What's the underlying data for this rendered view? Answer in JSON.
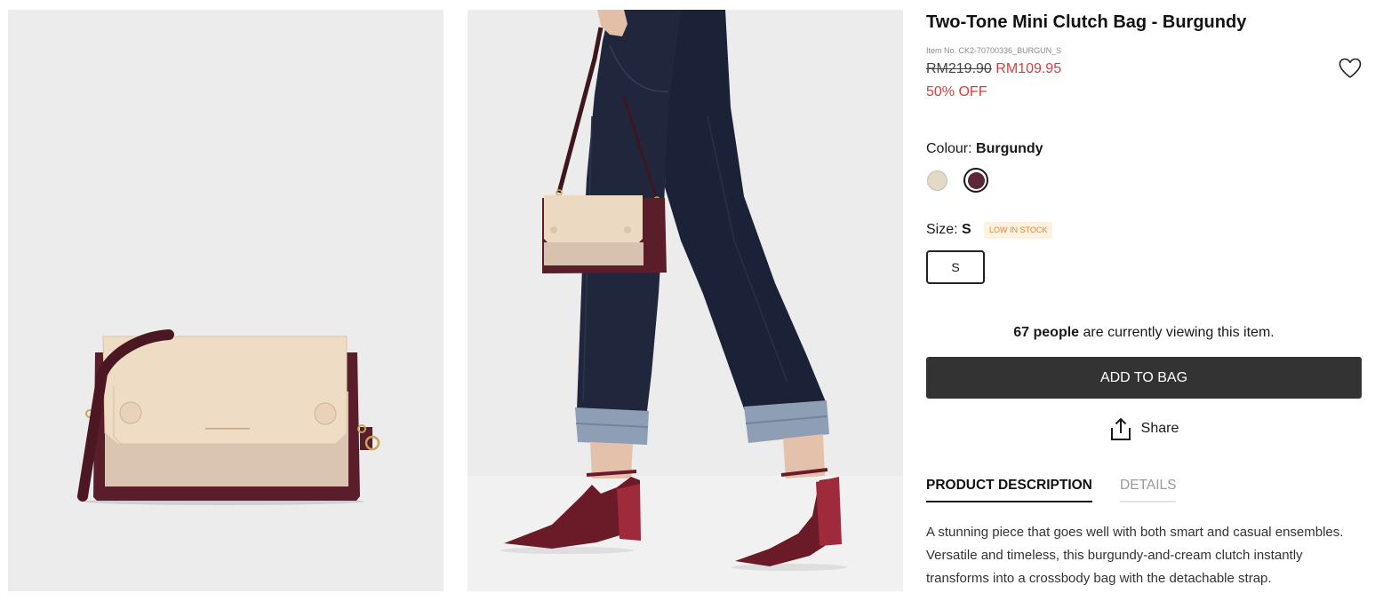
{
  "product": {
    "title": "Two-Tone Mini Clutch Bag - Burgundy",
    "item_no": "Item No. CK2-70700336_BURGUN_S",
    "original_price": "RM219.90",
    "sale_price": "RM109.95",
    "discount": "50% OFF"
  },
  "wishlist": {
    "icon": "heart-icon"
  },
  "colour": {
    "label": "Colour:",
    "selected": "Burgundy",
    "swatches": [
      {
        "color": "#e3d9c7",
        "selected": false
      },
      {
        "color": "#5b2739",
        "selected": true
      }
    ]
  },
  "size": {
    "label": "Size:",
    "selected": "S",
    "stock_badge": "LOW IN STOCK",
    "options": [
      "S"
    ]
  },
  "viewers": {
    "count": "67 people",
    "text": "are currently viewing this item."
  },
  "actions": {
    "add_to_bag": "ADD TO BAG",
    "share": "Share",
    "share_icon": "share-icon"
  },
  "tabs": [
    {
      "label": "PRODUCT DESCRIPTION",
      "active": true
    },
    {
      "label": "DETAILS",
      "active": false
    }
  ],
  "description": "A stunning piece that goes well with both smart and casual ensembles. Versatile and timeless, this burgundy-and-cream clutch instantly transforms into a crossbody bag with the detachable strap.",
  "theme": {
    "sale_color": "#d43f3a",
    "button_color": "#333333",
    "badge_text": "#e0873a",
    "badge_bg": "#fdf1e0",
    "image_bg": "#ececec"
  }
}
